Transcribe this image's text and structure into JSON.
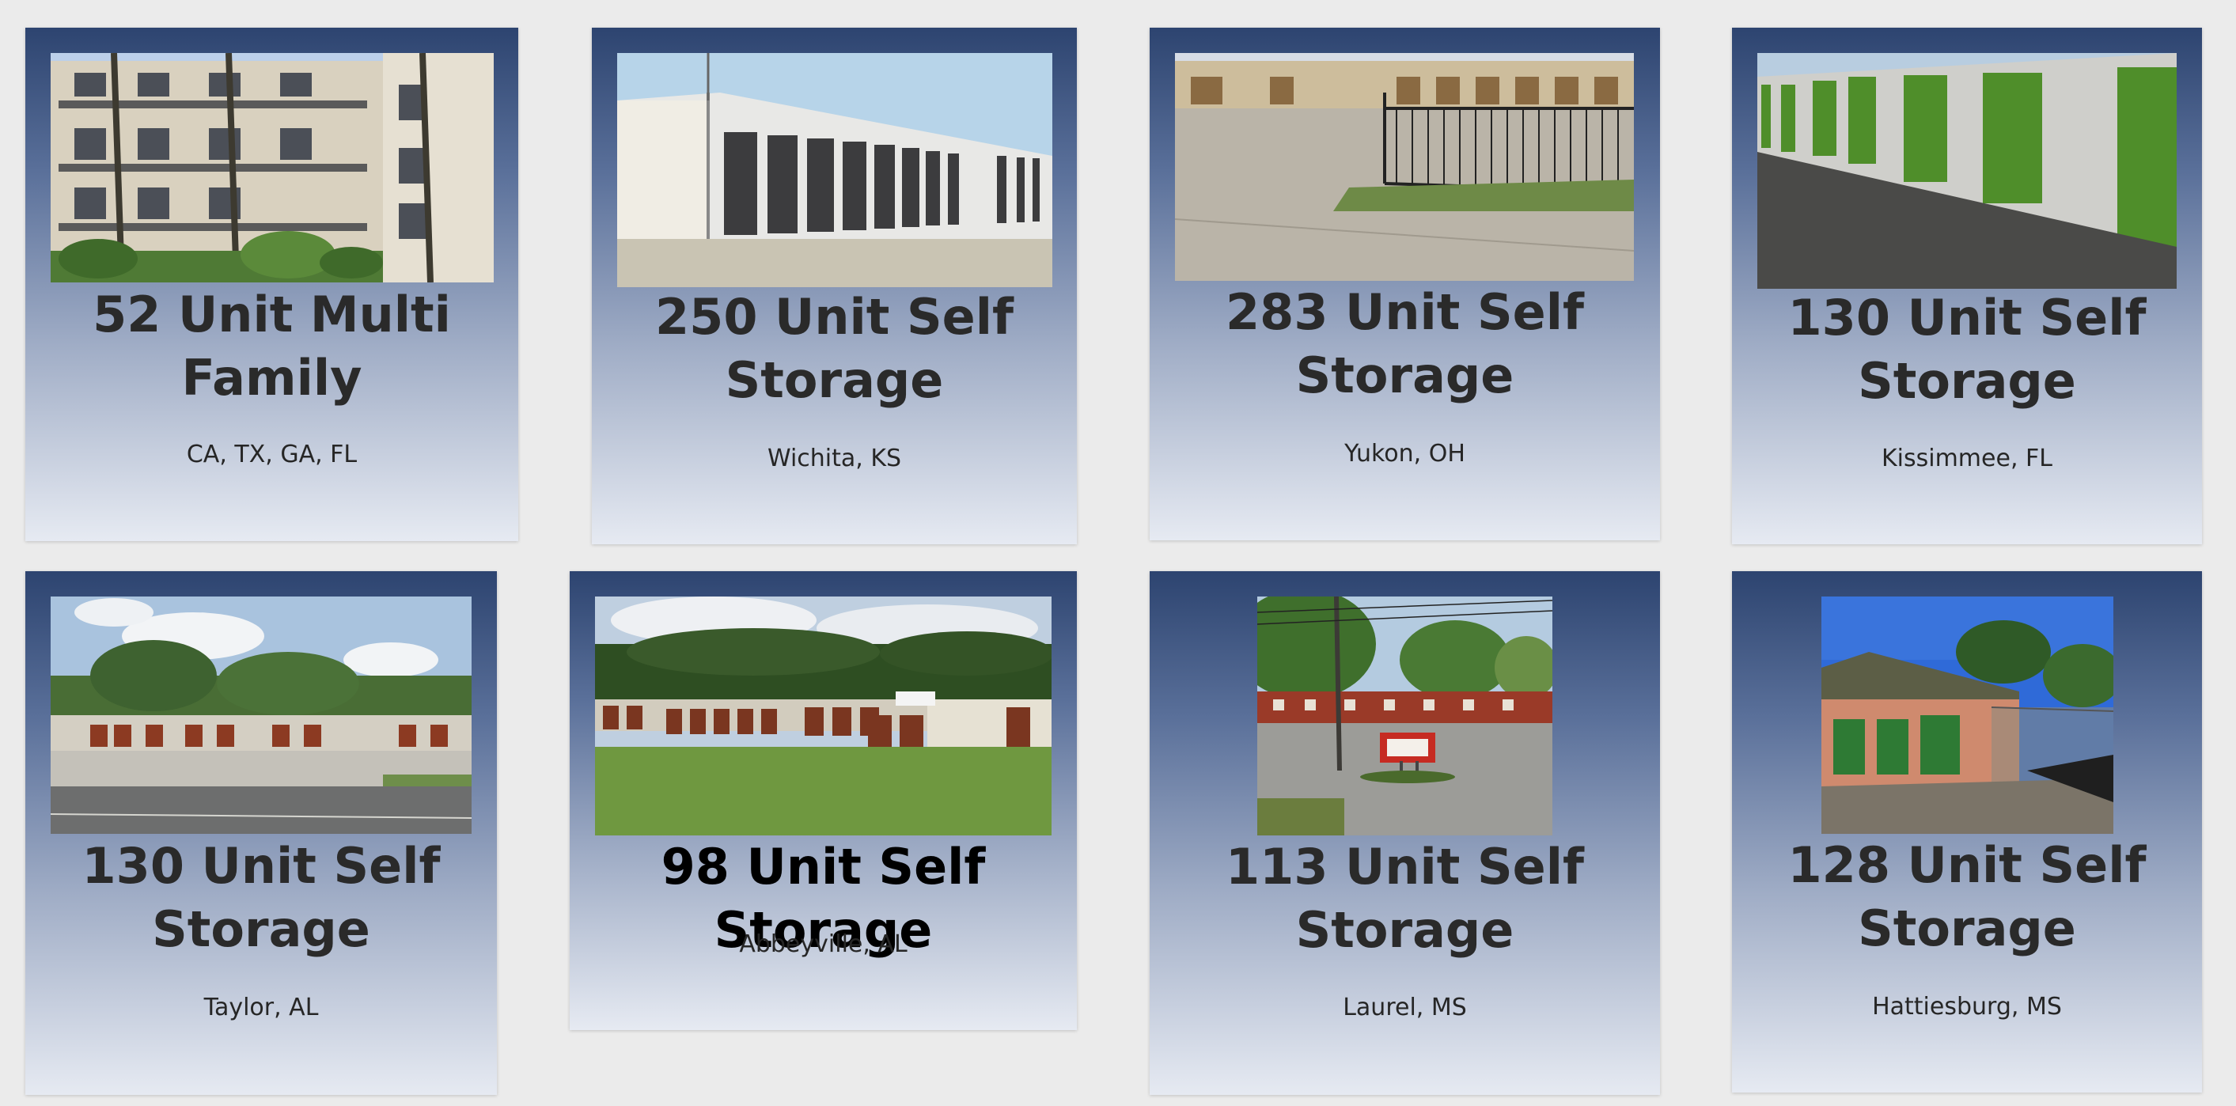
{
  "listings": [
    {
      "title": "52 Unit Multi Family",
      "location": "CA, TX, GA, FL",
      "photo": "apartment-building"
    },
    {
      "title": "250 Unit Self Storage",
      "location": "Wichita, KS",
      "photo": "storage-units-white"
    },
    {
      "title": "283 Unit Self Storage",
      "location": "Yukon, OH",
      "photo": "storage-gate"
    },
    {
      "title": "130 Unit Self Storage",
      "location": "Kissimmee, FL",
      "photo": "storage-units-green"
    },
    {
      "title": "130 Unit Self Storage",
      "location": "Taylor, AL",
      "photo": "storage-street-view"
    },
    {
      "title": "98 Unit Self Storage",
      "location": "Abbeyville, AL",
      "photo": "storage-grass-field"
    },
    {
      "title": "113 Unit Self Storage",
      "location": "Laurel, MS",
      "photo": "storage-sign-lot"
    },
    {
      "title": "128 Unit Self Storage",
      "location": "Hattiesburg, MS",
      "photo": "storage-brick-green-doors"
    }
  ]
}
